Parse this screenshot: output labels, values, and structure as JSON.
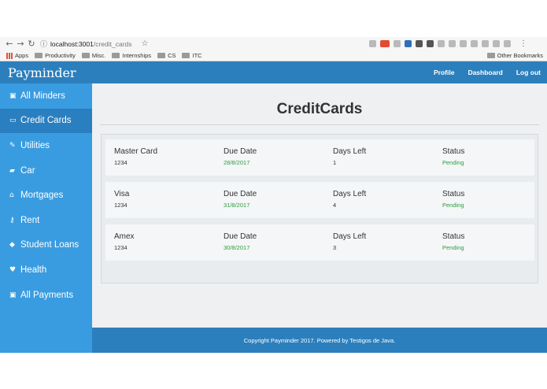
{
  "browser": {
    "url_host": "localhost:3001",
    "url_path": "/credit_cards",
    "bookmarks": [
      "Apps",
      "Productivity",
      "Misc.",
      "Internships",
      "CS",
      "ITC"
    ],
    "other_bookmarks": "Other Bookmarks"
  },
  "navbar": {
    "brand": "Payminder",
    "links": [
      "Profile",
      "Dashboard",
      "Log out"
    ]
  },
  "sidebar": {
    "items": [
      {
        "label": "All Minders",
        "icon": "money-icon"
      },
      {
        "label": "Credit Cards",
        "icon": "credit-card-icon",
        "active": true
      },
      {
        "label": "Utilities",
        "icon": "wrench-icon"
      },
      {
        "label": "Car",
        "icon": "car-icon"
      },
      {
        "label": "Mortgages",
        "icon": "home-icon"
      },
      {
        "label": "Rent",
        "icon": "key-icon"
      },
      {
        "label": "Student Loans",
        "icon": "graduation-cap-icon"
      },
      {
        "label": "Health",
        "icon": "heartbeat-icon"
      },
      {
        "label": "All Payments",
        "icon": "money-icon"
      }
    ]
  },
  "main": {
    "title": "CreditCards",
    "headers": [
      "Master Card",
      "Due Date",
      "Days Left",
      "Status"
    ],
    "cards": [
      {
        "name": "Master Card",
        "number": "1234",
        "due_date": "28/8/2017",
        "days_left": "1",
        "status": "Pending"
      },
      {
        "name": "Visa",
        "number": "1234",
        "due_date": "31/8/2017",
        "days_left": "4",
        "status": "Pending"
      },
      {
        "name": "Amex",
        "number": "1234",
        "due_date": "30/8/2017",
        "days_left": "3",
        "status": "Pending"
      }
    ],
    "labels": {
      "due_date": "Due Date",
      "days_left": "Days Left",
      "status": "Status"
    }
  },
  "footer": {
    "text": "Copyright Payminder 2017. Powered by Testigos de Java."
  },
  "colors": {
    "navbar": "#2c7fbd",
    "sidebar": "#3a9ce0",
    "sidebar_active": "#2a7fc0",
    "status_green": "#2e9d3c"
  }
}
